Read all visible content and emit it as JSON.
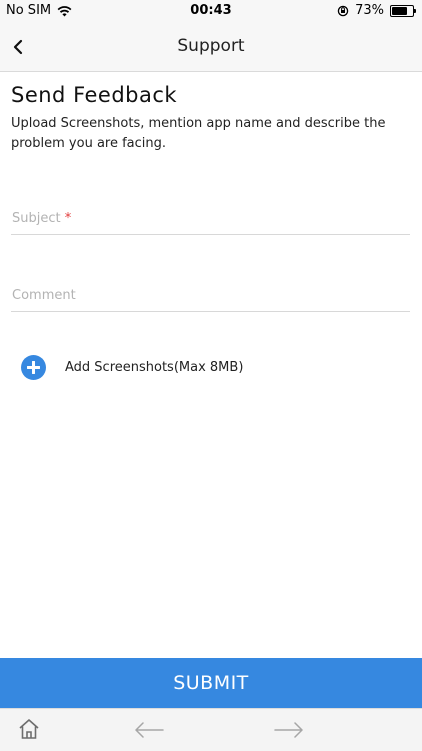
{
  "status_bar": {
    "carrier": "No SIM",
    "time": "00:43",
    "battery_percent": "73%",
    "battery_level": 0.73
  },
  "nav": {
    "title": "Support",
    "back_icon": "chevron-left-icon"
  },
  "content": {
    "heading": "Send Feedback",
    "description": "Upload Screenshots, mention app name and describe the problem you are facing.",
    "subject_placeholder": "Subject",
    "required_marker": "*",
    "comment_placeholder": "Comment",
    "add_screenshots_label": "Add Screenshots(Max 8MB)",
    "add_icon": "plus-circle-icon"
  },
  "submit_label": "SUBMIT",
  "toolbar": {
    "icons": [
      "home-icon",
      "arrow-left-icon",
      "arrow-right-icon"
    ]
  },
  "colors": {
    "accent": "#3688e0",
    "required": "#e23b3b",
    "placeholder": "#b3b3b3"
  }
}
